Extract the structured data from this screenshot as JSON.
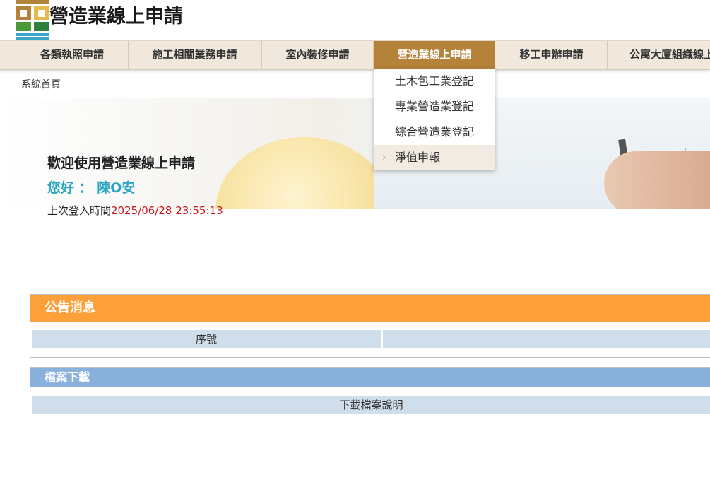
{
  "site": {
    "title": "營造業線上申請"
  },
  "nav": {
    "items": [
      {
        "label": "各類執照申請"
      },
      {
        "label": "施工相關業務申請"
      },
      {
        "label": "室內裝修申請"
      },
      {
        "label": "營造業線上申請"
      },
      {
        "label": "移工申辦申請"
      },
      {
        "label": "公寓大廈組織線上"
      }
    ],
    "active_index": 3,
    "active_color": "#b5823a",
    "background_color": "#f0e8dc"
  },
  "dropdown": {
    "items": [
      {
        "label": "土木包工業登記"
      },
      {
        "label": "專業營造業登記"
      },
      {
        "label": "綜合營造業登記"
      },
      {
        "label": "淨值申報"
      }
    ],
    "hover_index": 3,
    "hover_icon": "chevron-right-icon"
  },
  "breadcrumb": {
    "label": "系統首頁"
  },
  "welcome": {
    "title": "歡迎使用營造業線上申請",
    "greeting": "您好 ： 陳O安",
    "last_login_label": "上次登入時間",
    "last_login_time": "2025/06/28 23:55:13"
  },
  "announcements": {
    "title": "公告消息",
    "columns": [
      "序號",
      ""
    ],
    "header_color": "#fda03a"
  },
  "downloads": {
    "title": "檔案下載",
    "columns": [
      "下載檔案說明"
    ],
    "header_color": "#8ab0dc"
  }
}
